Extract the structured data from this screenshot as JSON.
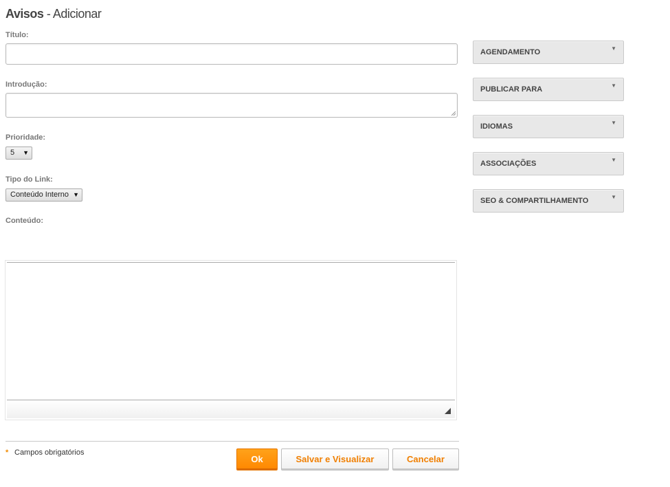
{
  "header": {
    "title_strong": "Avisos",
    "title_rest": " - Adicionar"
  },
  "form": {
    "titulo": {
      "label": "Título:",
      "value": ""
    },
    "introducao": {
      "label": "Introdução:",
      "value": ""
    },
    "prioridade": {
      "label": "Prioridade:",
      "value": "5"
    },
    "tipo_link": {
      "label": "Tipo do Link:",
      "value": "Conteúdo Interno"
    },
    "conteudo": {
      "label": "Conteúdo:"
    }
  },
  "sidebar": {
    "panels": [
      {
        "label": "AGENDAMENTO"
      },
      {
        "label": "PUBLICAR PARA"
      },
      {
        "label": "IDIOMAS"
      },
      {
        "label": "ASSOCIAÇÕES"
      },
      {
        "label": "SEO & COMPARTILHAMENTO"
      }
    ]
  },
  "footer": {
    "required_marker": "*",
    "required_text": "Campos obrigatórios",
    "ok_label": "Ok",
    "save_view_label": "Salvar e Visualizar",
    "cancel_label": "Cancelar"
  },
  "icons": {
    "dropdown": "chevron-down-icon",
    "resize": "resize-grip-icon"
  },
  "colors": {
    "accent": "#ff8c00",
    "panel_bg": "#e8e8e8"
  }
}
